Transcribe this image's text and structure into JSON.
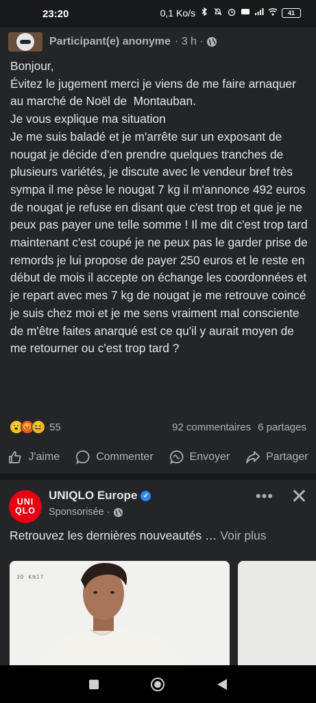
{
  "status_bar": {
    "time": "23:20",
    "net_speed": "0,1 Ko/s",
    "battery": "41"
  },
  "post1": {
    "author": "Participant(e) anonyme",
    "time": "· 3 h ·",
    "body": "Bonjour,\nÉvitez le jugement merci je viens de me faire arnaquer au marché de Noël de  Montauban.\nJe vous explique ma situation\nJe me suis baladé et je m'arrête sur un exposant de nougat je décide d'en prendre quelques tranches de plusieurs variétés, je discute avec le vendeur bref très sympa il me pèse le nougat 7 kg il m'annonce 492 euros de nougat je refuse en disant que c'est trop et que je ne peux pas payer une telle somme ! Il me dit c'est trop tard maintenant c'est coupé je ne peux pas le garder prise de remords je lui propose de payer 250 euros et le reste en début de mois il accepte on échange les coordonnées et je repart avec mes 7 kg de nougat je me retrouve coincé je suis chez moi et je me sens vraiment mal consciente de m'être faites anarqué est ce qu'il y aurait moyen de me retourner ou c'est trop tard ?",
    "reaction_count": "55",
    "comments": "92 commentaires",
    "shares": "6 partages",
    "actions": {
      "like": "J'aime",
      "comment": "Commenter",
      "send": "Envoyer",
      "share": "Partager"
    }
  },
  "post2": {
    "page_name": "UNIQLO Europe",
    "logo_line1": "UNI",
    "logo_line2": "QLO",
    "sponsored": "Sponsorisée ·",
    "text": "Retrouvez les dernières nouveautés … ",
    "see_more": "Voir plus",
    "card_tag": "3D KNIT"
  },
  "colors": {
    "background": "#242526",
    "text": "#e4e6eb",
    "muted": "#b0b3b8",
    "uniqlo_red": "#e60012",
    "verified_blue": "#2d88ff"
  }
}
